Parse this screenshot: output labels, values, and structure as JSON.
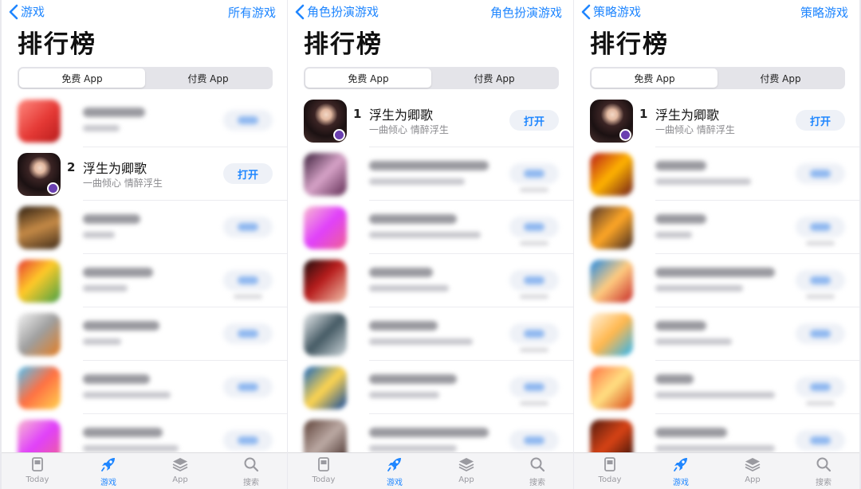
{
  "colors": {
    "accent": "#1f86ff"
  },
  "tabbar_items": [
    {
      "label": "Today",
      "icon": "today-icon"
    },
    {
      "label": "游戏",
      "icon": "rocket-icon"
    },
    {
      "label": "App",
      "icon": "stack-icon"
    },
    {
      "label": "搜索",
      "icon": "search-icon"
    }
  ],
  "panels": [
    {
      "nav": {
        "back_label": "游戏",
        "right_label": "所有游戏"
      },
      "title": "排行榜",
      "segments": {
        "free": "免费 App",
        "paid": "付费 App"
      },
      "featured": {
        "rank": "2",
        "name": "浮生为卿歌",
        "subtitle": "一曲倾心 情醉浮生",
        "button": "打开"
      }
    },
    {
      "nav": {
        "back_label": "角色扮演游戏",
        "right_label": "角色扮演游戏"
      },
      "title": "排行榜",
      "segments": {
        "free": "免费 App",
        "paid": "付费 App"
      },
      "featured": {
        "rank": "1",
        "name": "浮生为卿歌",
        "subtitle": "一曲倾心 情醉浮生",
        "button": "打开"
      }
    },
    {
      "nav": {
        "back_label": "策略游戏",
        "right_label": "策略游戏"
      },
      "title": "排行榜",
      "segments": {
        "free": "免费 App",
        "paid": "付费 App"
      },
      "featured": {
        "rank": "1",
        "name": "浮生为卿歌",
        "subtitle": "一曲倾心 情醉浮生",
        "button": "打开"
      }
    }
  ]
}
